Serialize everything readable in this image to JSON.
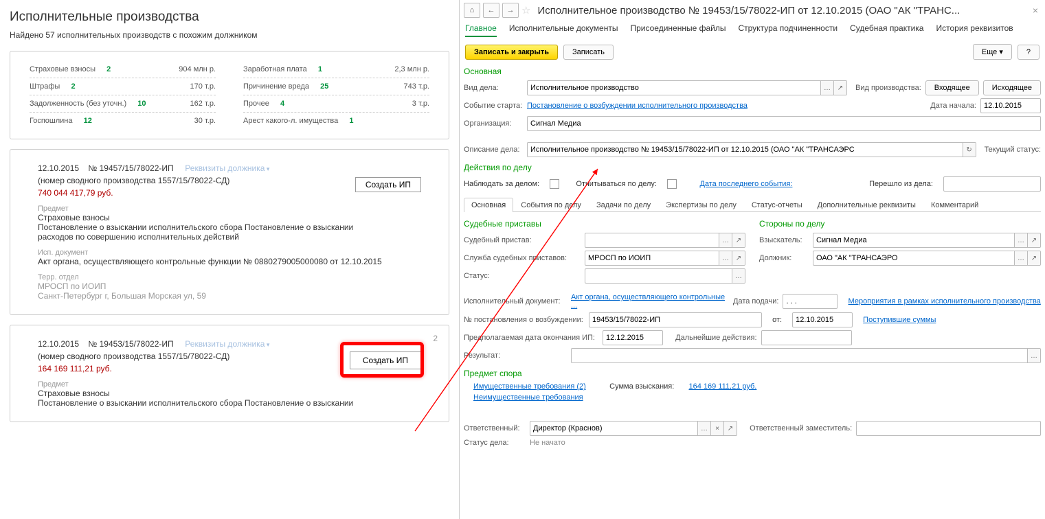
{
  "left": {
    "title": "Исполнительные производства",
    "found": "Найдено 57 исполнительных производств с похожим должником",
    "stats1": [
      {
        "lab": "Страховые взносы",
        "cnt": "2",
        "amt": "904 млн р."
      },
      {
        "lab": "Штрафы",
        "cnt": "2",
        "amt": "170 т.р."
      },
      {
        "lab": "Задолженность (без уточн.)",
        "cnt": "10",
        "amt": "162 т.р."
      },
      {
        "lab": "Госпошлина",
        "cnt": "12",
        "amt": "30 т.р."
      }
    ],
    "stats2": [
      {
        "lab": "Заработная плата",
        "cnt": "1",
        "amt": "2,3 млн р."
      },
      {
        "lab": "Причинение вреда",
        "cnt": "25",
        "amt": "743 т.р."
      },
      {
        "lab": "Прочее",
        "cnt": "4",
        "amt": "3 т.р."
      },
      {
        "lab": "Арест какого-л. имущества",
        "cnt": "1",
        "amt": ""
      }
    ],
    "card1": {
      "date": "12.10.2015",
      "num": "№ 19457/15/78022-ИП",
      "debtor_link": "Реквизиты должника",
      "summary": "(номер сводного производства 1557/15/78022-СД)",
      "amount": "740 044 417,79 руб.",
      "subj_lab": "Предмет",
      "subj_name": "Страховые взносы",
      "subj_text": "Постановление о взыскании исполнительского сбора Постановление о взыскании расходов по совершению исполнительных действий",
      "doc_lab": "Исп. документ",
      "doc_text": "Акт органа, осуществляющего контрольные функции № 0880279005000080 от 12.10.2015",
      "terr_lab": "Терр. отдел",
      "terr1": "МРОСП по ИОИП",
      "terr2": "Санкт-Петербург г, Большая Морская ул, 59",
      "btn": "Создать ИП"
    },
    "card2": {
      "badge": "2",
      "date": "12.10.2015",
      "num": "№ 19453/15/78022-ИП",
      "debtor_link": "Реквизиты должника",
      "summary": "(номер сводного производства 1557/15/78022-СД)",
      "amount": "164 169 111,21 руб.",
      "subj_lab": "Предмет",
      "subj_name": "Страховые взносы",
      "subj_text": "Постановление о взыскании исполнительского сбора Постановление о взыскании",
      "btn": "Создать ИП"
    }
  },
  "right": {
    "nav": {
      "home": "⌂",
      "back": "←",
      "fwd": "→"
    },
    "title": "Исполнительное производство № 19453/15/78022-ИП от 12.10.2015 (ОАО \"АК \"ТРАНС...",
    "tabs": [
      "Главное",
      "Исполнительные документы",
      "Присоединенные файлы",
      "Структура подчиненности",
      "Судебная практика",
      "История реквизитов"
    ],
    "btn_saveclose": "Записать и закрыть",
    "btn_save": "Записать",
    "btn_more": "Еще",
    "btn_help": "?",
    "sec_main": "Основная",
    "vid_lab": "Вид дела:",
    "vid_val": "Исполнительное производство",
    "proizv_lab": "Вид производства:",
    "proizv_in": "Входящее",
    "proizv_out": "Исходящее",
    "start_lab": "Событие старта:",
    "start_link": "Постановление о возбуждении исполнительного производства ",
    "date_start_lab": "Дата начала:",
    "date_start": "12.10.2015",
    "org_lab": "Организация:",
    "org_val": "Сигнал Медиа",
    "desc_lab": "Описание дела:",
    "desc_val": "Исполнительное производство № 19453/15/78022-ИП от 12.10.2015 (ОАО \"АК \"ТРАНСАЭРС",
    "curstat_lab": "Текущий статус:",
    "sec_actions": "Действия по делу",
    "watch_lab": "Наблюдать за делом:",
    "report_lab": "Отчитываться по делу:",
    "lastevent_lab": "Дата последнего события:",
    "from_lab": "Перешло из дела:",
    "subtabs": [
      "Основная",
      "События по делу",
      "Задачи по делу",
      "Экспертизы по делу",
      "Статус-отчеты",
      "Дополнительные реквизиты",
      "Комментарий"
    ],
    "bailiffs_head": "Судебные приставы",
    "parties_head": "Стороны по делу",
    "bailiff_lab": "Судебный пристав:",
    "service_lab": "Служба судебных приставов:",
    "service_val": "МРОСП по ИОИП",
    "status_lab": "Статус:",
    "claimant_lab": "Взыскатель:",
    "claimant_val": "Сигнал Медиа",
    "debtor_lab": "Должник:",
    "debtor_val": "ОАО \"АК \"ТРАНСАЭРО",
    "execdoc_lab": "Исполнительный документ:",
    "execdoc_link": "Акт органа, осуществляющего контрольные ...",
    "filed_lab": "Дата подачи:",
    "filed_val": ". . .",
    "measures_link": "Мероприятия в рамках исполнительного производства",
    "decree_lab": "№ постановления о возбуждении:",
    "decree_val": "19453/15/78022-ИП",
    "decree_from": "от:",
    "decree_date": "12.10.2015",
    "incoming_link": "Поступившие суммы",
    "expdate_lab": "Предполагаемая дата окончания ИП:",
    "expdate_val": "12.12.2015",
    "further_lab": "Дальнейшие действия:",
    "result_lab": "Результат:",
    "dispute_head": "Предмет спора",
    "prop_claims": "Имущественные требования (2)",
    "sum_lab": "Сумма взыскания:",
    "sum_val": "164 169 111,21 руб.",
    "nonprop_claims": "Неимущественные требования",
    "resp_lab": "Ответственный:",
    "resp_val": "Директор (Краснов)",
    "deputy_lab": "Ответственный заместитель:",
    "case_stat_lab": "Статус дела:",
    "case_stat_val": "Не начато"
  }
}
